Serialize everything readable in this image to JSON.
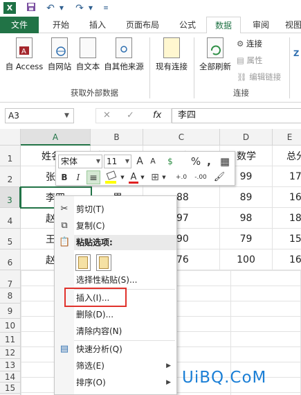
{
  "titlebar": {
    "logo": "X",
    "undo": "↶",
    "redo": "↷"
  },
  "tabs": [
    "文件",
    "开始",
    "插入",
    "页面布局",
    "公式",
    "数据",
    "审阅",
    "视图"
  ],
  "ribbon": {
    "external_data": {
      "buttons": [
        "自 Access",
        "自网站",
        "自文本",
        "自其他来源"
      ],
      "existing": "现有连接",
      "group_label": "获取外部数据"
    },
    "connections": {
      "refresh_all": "全部刷新",
      "connection": "连接",
      "properties": "属性",
      "edit_links": "编辑链接",
      "group_label": "连接"
    }
  },
  "formula_bar": {
    "name_box": "A3",
    "cancel": "✕",
    "enter": "✓",
    "fx": "fx",
    "value": "李四"
  },
  "grid": {
    "columns": [
      "A",
      "B",
      "C",
      "D",
      "E"
    ],
    "rows": [
      "1",
      "2",
      "3",
      "4",
      "5",
      "6",
      "7",
      "8",
      "9",
      "10",
      "11",
      "12",
      "13",
      "14",
      "15",
      "16"
    ],
    "cells": [
      [
        "姓名",
        "性别",
        "语文",
        "数学",
        "总分"
      ],
      [
        "张三",
        "",
        "",
        "99",
        "178"
      ],
      [
        "李四",
        "男",
        "88",
        "89",
        "167"
      ],
      [
        "赵",
        "",
        "97",
        "98",
        "185"
      ],
      [
        "王",
        "",
        "90",
        "79",
        "159"
      ],
      [
        "赵",
        "",
        "76",
        "100",
        "166"
      ]
    ]
  },
  "mini_toolbar": {
    "font": "宋体",
    "size": "11",
    "grow": "A",
    "shrink": "A",
    "number_format": "$",
    "percent": "%",
    "comma": ",",
    "format_table": "▦",
    "bold": "B",
    "italic": "I",
    "align": "≡",
    "fill_color": "#ffff00",
    "font_color_label": "A",
    "font_color": "#e02020",
    "borders": "⊞",
    "inc_decimal": "+.0",
    "dec_decimal": "-.00",
    "painter": "🖌"
  },
  "context_menu": {
    "cut": "剪切(T)",
    "copy": "复制(C)",
    "paste_options": "粘贴选项:",
    "paste_special": "选择性粘贴(S)...",
    "insert": "插入(I)...",
    "delete": "删除(D)...",
    "clear": "清除内容(N)",
    "quick_analysis": "快速分析(Q)",
    "filter": "筛选(E)",
    "sort": "排序(O)"
  },
  "watermark": "UiBQ.CoM"
}
